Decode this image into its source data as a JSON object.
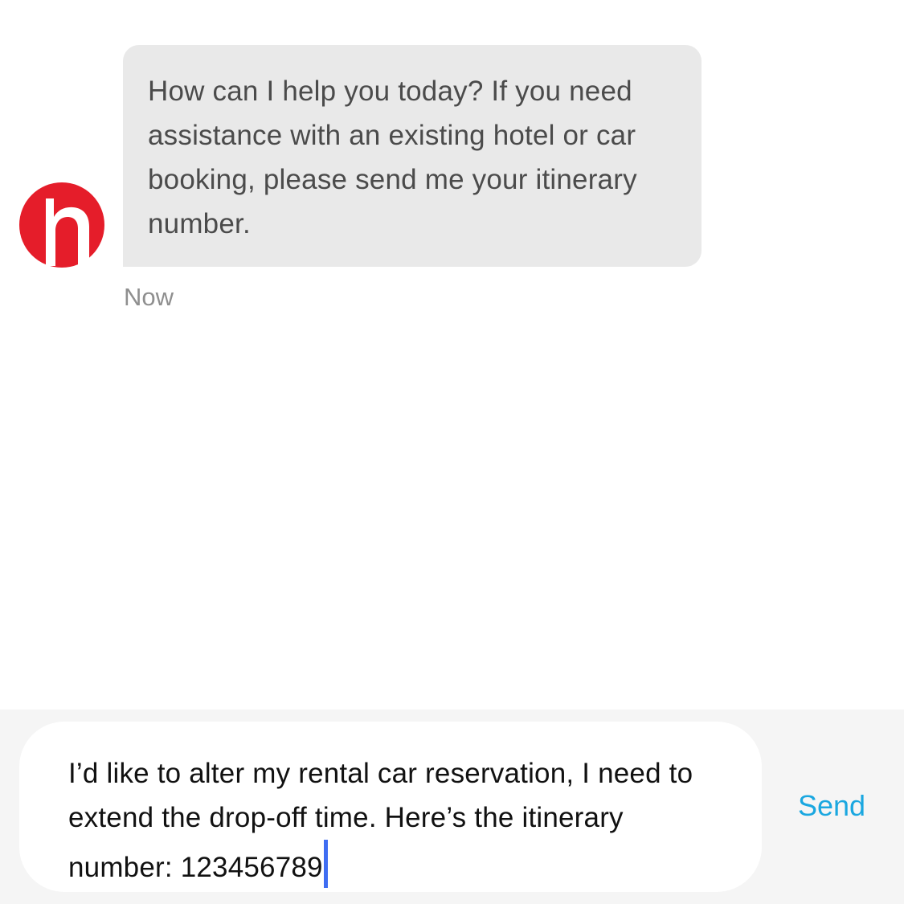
{
  "conversation": {
    "agent_avatar_icon": "hotels-h-logo-icon",
    "brand_color": "#e51d2a",
    "agent_message": "How can I help you today? If you need assistance with an existing hotel or car booking, please send me your itinerary number.",
    "timestamp": "Now"
  },
  "composer": {
    "draft_text": "I’d like to alter my rental car reservation, I need to extend the drop-off time. Here’s the itinerary number: 123456789",
    "send_label": "Send",
    "send_color": "#1aa7e0",
    "caret_color": "#3f6df2"
  }
}
